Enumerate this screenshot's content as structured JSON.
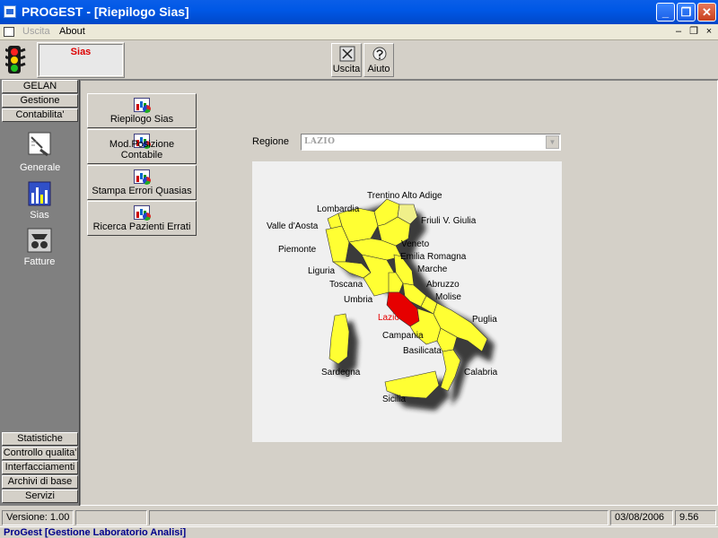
{
  "window": {
    "title": "PROGEST - [Riepilogo Sias]",
    "buttons": {
      "minimize": "_",
      "restore": "❐",
      "close": "✕"
    }
  },
  "menubar": {
    "items": [
      {
        "label": "Uscita",
        "disabled": true
      },
      {
        "label": "About",
        "disabled": false
      }
    ],
    "mdi": {
      "minimize": "–",
      "restore": "❐",
      "close": "×"
    }
  },
  "toolbar": {
    "module_label": "Sias",
    "uscita_label": "Uscita",
    "aiuto_label": "Aiuto"
  },
  "leftnav": {
    "top_headers": [
      "GELAN",
      "Gestione",
      "Contabilita'"
    ],
    "icons": [
      {
        "label": "Generale",
        "icon": "document-icon"
      },
      {
        "label": "Sias",
        "icon": "chart-icon"
      },
      {
        "label": "Fatture",
        "icon": "invoice-icon"
      }
    ],
    "bottom_headers": [
      "Statistiche",
      "Controllo qualita'",
      "Interfacciamenti",
      "Archivi di base",
      "Servizi"
    ]
  },
  "side_buttons": [
    "Riepilogo Sias",
    "Mod.Posizione Contabile",
    "Stampa Errori Quasias",
    "Ricerca Pazienti Errati"
  ],
  "region": {
    "label": "Regione",
    "value": "LAZIO"
  },
  "map": {
    "highlight_color": "#e60000",
    "region_color": "#ffff33",
    "labels": [
      "Trentino Alto Adige",
      "Lombardia",
      "Friuli V. Giulia",
      "Valle d'Aosta",
      "Veneto",
      "Piemonte",
      "Emilia Romagna",
      "Liguria",
      "Marche",
      "Toscana",
      "Abruzzo",
      "Umbria",
      "Molise",
      "Lazio",
      "Puglia",
      "Campania",
      "Basilicata",
      "Sardegna",
      "Calabria",
      "Sicilia"
    ]
  },
  "statusbar": {
    "version": "Versione: 1.00",
    "date": "03/08/2006",
    "time": "9.56"
  },
  "taskbar": {
    "label": "ProGest [Gestione Laboratorio Analisi]"
  }
}
